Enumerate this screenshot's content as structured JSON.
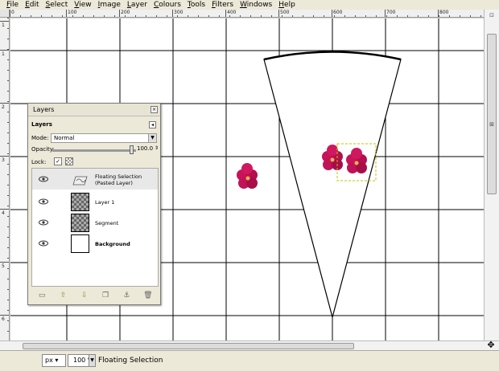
{
  "menu": [
    "File",
    "Edit",
    "Select",
    "View",
    "Image",
    "Layer",
    "Colours",
    "Tools",
    "Filters",
    "Windows",
    "Help"
  ],
  "ruler_top_ticks": [
    "0",
    "100",
    "200",
    "300",
    "400",
    "500",
    "600",
    "700",
    "800"
  ],
  "ruler_left_ticks": [
    "1",
    "1",
    "2",
    "3",
    "4",
    "5",
    "6",
    "7",
    "8"
  ],
  "layers_dialog": {
    "title": "Layers",
    "tab": "Layers",
    "mode_label": "Mode:",
    "mode_value": "Normal",
    "opacity_label": "Opacity:",
    "opacity_value": "100.0",
    "lock_label": "Lock:",
    "layers": [
      {
        "name_line1": "Floating Selection",
        "name_line2": "(Pasted Layer)",
        "thumb": "floating-icon"
      },
      {
        "name_line1": "Layer 1",
        "name_line2": "",
        "thumb": "checker"
      },
      {
        "name_line1": "Segment",
        "name_line2": "",
        "thumb": "checker"
      },
      {
        "name_line1": "Background",
        "name_line2": "",
        "thumb": "white"
      }
    ],
    "footer_icons": [
      "new-layer-icon",
      "raise-layer-icon",
      "lower-layer-icon",
      "duplicate-layer-icon",
      "anchor-layer-icon",
      "delete-layer-icon"
    ]
  },
  "status": {
    "unit": "px",
    "zoom": "100 %",
    "message": "Floating Selection"
  },
  "colors": {
    "flower": "#c8125a",
    "flower_center": "#e8b44a",
    "selection": "#c8c000"
  }
}
